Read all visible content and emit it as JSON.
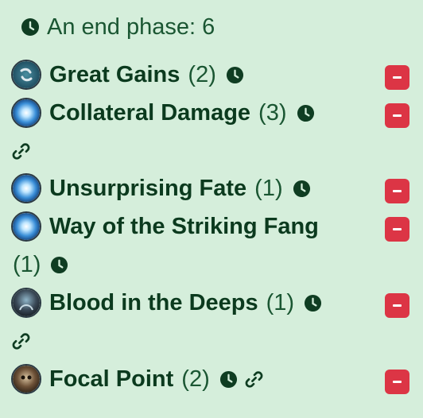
{
  "header": {
    "title": "An end phase: 6",
    "icon": "clock-icon"
  },
  "colors": {
    "background": "#d5eedb",
    "text": "#0b3a1e",
    "remove": "#dc3545"
  },
  "cards": [
    {
      "name": "Great Gains",
      "count": "(2)",
      "avatar": "great-gains-avatar",
      "linked": false
    },
    {
      "name": "Collateral Damage",
      "count": "(3)",
      "avatar": "blue-burst-avatar",
      "linked": true
    },
    {
      "name": "Unsurprising Fate",
      "count": "(1)",
      "avatar": "blue-burst-avatar",
      "linked": false
    },
    {
      "name": "Way of the Striking Fang",
      "count": "(1)",
      "avatar": "blue-burst-avatar",
      "linked": false
    },
    {
      "name": "Blood in the Deeps",
      "count": "(1)",
      "avatar": "armored-creature-avatar",
      "linked": true
    },
    {
      "name": "Focal Point",
      "count": "(2)",
      "avatar": "skull-portrait-avatar",
      "linked": true
    }
  ]
}
